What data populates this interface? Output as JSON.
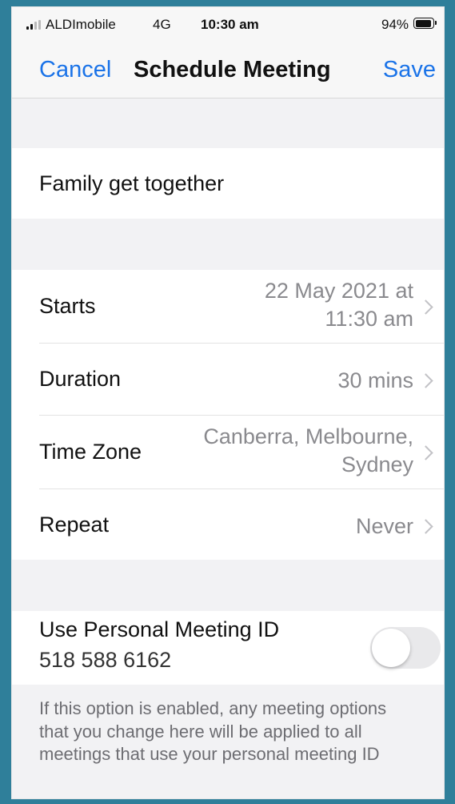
{
  "status_bar": {
    "carrier": "ALDImobile",
    "network": "4G",
    "time": "10:30 am",
    "battery": "94%",
    "battery_level": 0.94
  },
  "nav": {
    "cancel": "Cancel",
    "title": "Schedule Meeting",
    "save": "Save"
  },
  "topic": "Family get together",
  "rows": [
    {
      "label": "Starts",
      "value_line1": "22 May 2021 at",
      "value_line2": "11:30 am"
    },
    {
      "label": "Duration",
      "value_line1": "30 mins"
    },
    {
      "label": "Time Zone",
      "value_line1": "Canberra, Melbourne,",
      "value_line2": "Sydney"
    },
    {
      "label": "Repeat",
      "value_line1": "Never"
    }
  ],
  "personal_meeting": {
    "label": "Use Personal Meeting ID",
    "id": "518 588 6162",
    "enabled": false
  },
  "footnote": "If this option is enabled, any meeting options that you change here will be applied to all meetings that use your personal meeting ID",
  "colors": {
    "accent": "#1a73e8",
    "secondary_text": "#8a8a8e",
    "background": "#f2f2f4"
  }
}
